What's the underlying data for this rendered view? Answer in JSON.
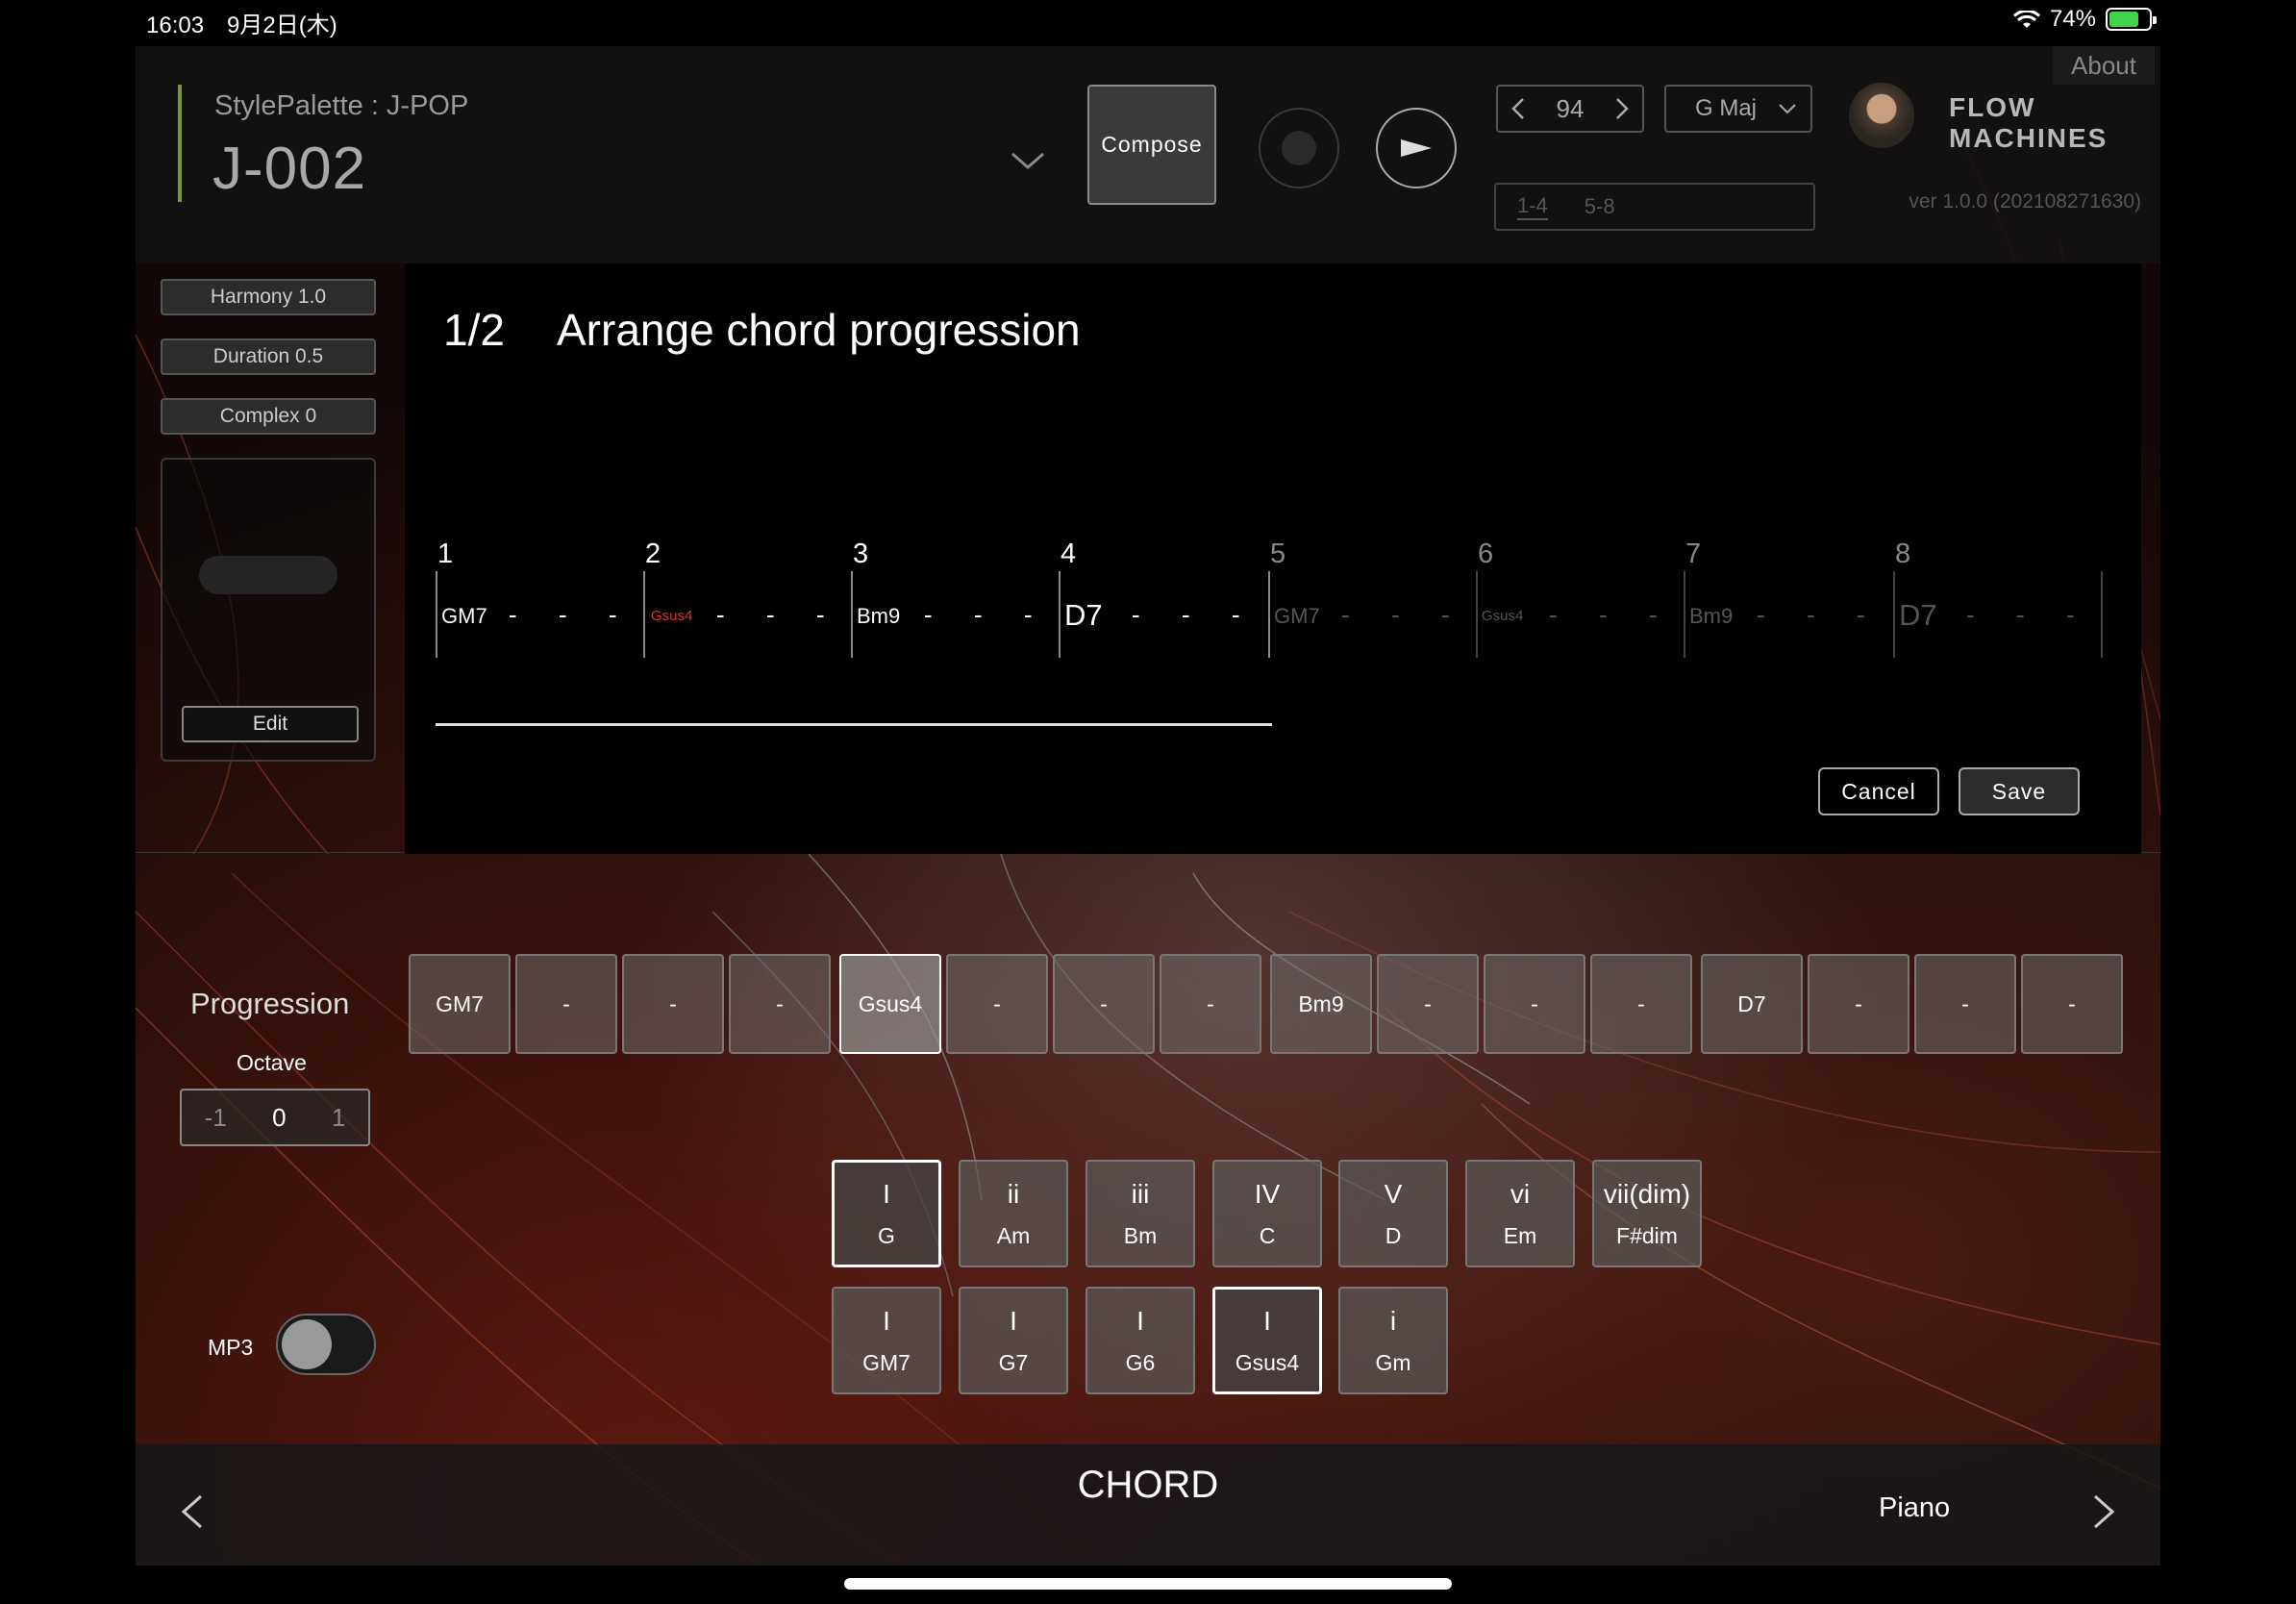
{
  "status_bar": {
    "time": "16:03　9月2日(木)",
    "battery": "74%"
  },
  "header": {
    "style_palette": "StylePalette : J-POP",
    "song_title": "J-002",
    "compose_label": "Compose",
    "tempo": "94",
    "key": "G Maj",
    "logo": "FLOW MACHINES",
    "about_label": "About",
    "pager": [
      "1-4",
      "5-8"
    ],
    "version": "ver 1.0.0 (202108271630)"
  },
  "left_panel": {
    "harmony": "Harmony 1.0",
    "duration": "Duration 0.5",
    "complex": "Complex 0",
    "edit_label": "Edit"
  },
  "dialog": {
    "step": "1/2",
    "title": "Arrange chord progression",
    "bars": [
      "1",
      "2",
      "3",
      "4",
      "5",
      "6",
      "7",
      "8"
    ],
    "chords": [
      "GM7",
      "Gsus4",
      "Bm9",
      "D7",
      "GM7",
      "Gsus4",
      "Bm9",
      "D7"
    ],
    "dash": "-",
    "cancel_label": "Cancel",
    "save_label": "Save"
  },
  "progression": {
    "label": "Progression",
    "octave_label": "Octave",
    "octave_options": [
      "-1",
      "0",
      "1"
    ],
    "octave_selected": "0",
    "cells": [
      "GM7",
      "-",
      "-",
      "-",
      "Gsus4",
      "-",
      "-",
      "-",
      "Bm9",
      "-",
      "-",
      "-",
      "D7",
      "-",
      "-",
      "-"
    ],
    "selected_index": 4
  },
  "chord_pads": {
    "row1": [
      {
        "degree": "I",
        "name": "G"
      },
      {
        "degree": "ii",
        "name": "Am"
      },
      {
        "degree": "iii",
        "name": "Bm"
      },
      {
        "degree": "IV",
        "name": "C"
      },
      {
        "degree": "V",
        "name": "D"
      },
      {
        "degree": "vi",
        "name": "Em"
      },
      {
        "degree": "vii(dim)",
        "name": "F#dim"
      }
    ],
    "row2": [
      {
        "degree": "I",
        "name": "GM7"
      },
      {
        "degree": "I",
        "name": "G7"
      },
      {
        "degree": "I",
        "name": "G6"
      },
      {
        "degree": "I",
        "name": "Gsus4"
      },
      {
        "degree": "i",
        "name": "Gm"
      }
    ]
  },
  "mp3": {
    "label": "MP3",
    "enabled": false
  },
  "bottom_bar": {
    "title": "CHORD",
    "instrument": "Piano"
  },
  "colors": {
    "accent_green": "#7a9a3a",
    "chord_red": "#e03030"
  }
}
